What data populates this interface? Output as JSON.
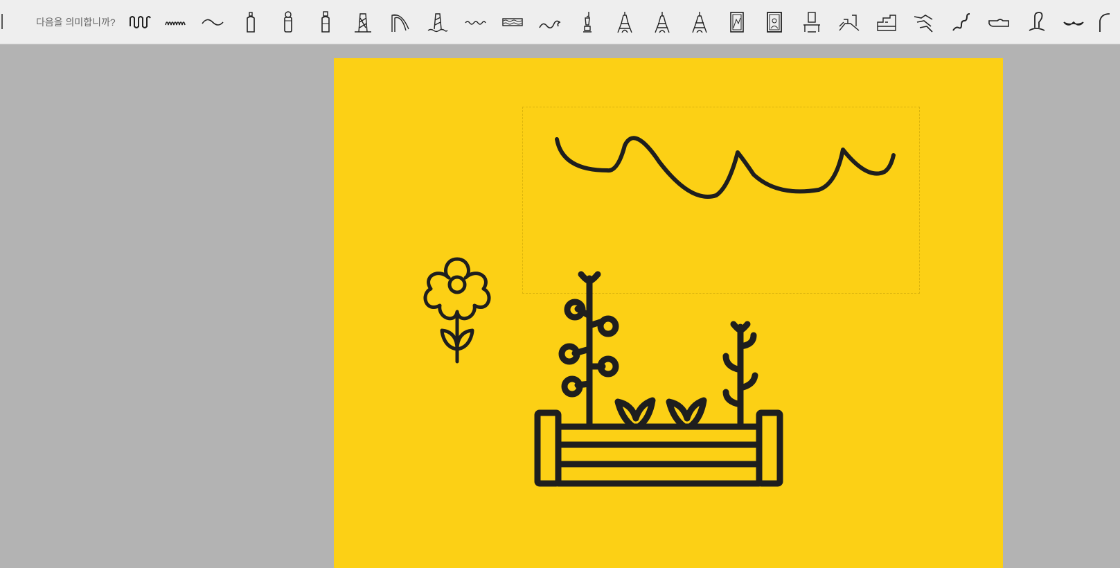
{
  "toolbar": {
    "prompt": "다음을  의미합니까?",
    "suggestions": [
      "wavy-zigzag-icon",
      "squiggle-icon",
      "tilde-wave-icon",
      "bottle-icon",
      "column-icon",
      "tall-bottle-icon",
      "twisted-tower-icon",
      "arch-slide-icon",
      "spiral-tower-water-icon",
      "small-wave-icon",
      "water-wavy-rect-icon",
      "ocean-wave-icon",
      "statue-of-liberty-icon",
      "eiffel-tower-icon",
      "eiffel-tower-2-icon",
      "eiffel-tower-3-icon",
      "framed-art-icon",
      "framed-art-2-icon",
      "museum-exhibit-icon",
      "great-wall-icon",
      "fortress-icon",
      "dragon-icon",
      "serpent-icon",
      "hand-icon",
      "cobra-icon",
      "mustache-icon",
      "arch-partial-icon"
    ]
  },
  "canvas": {
    "background": "#fcd015",
    "stroke": "#1e1e1e",
    "items": [
      "scribble-wave",
      "flower-doodle",
      "garden-planter-icon"
    ]
  }
}
